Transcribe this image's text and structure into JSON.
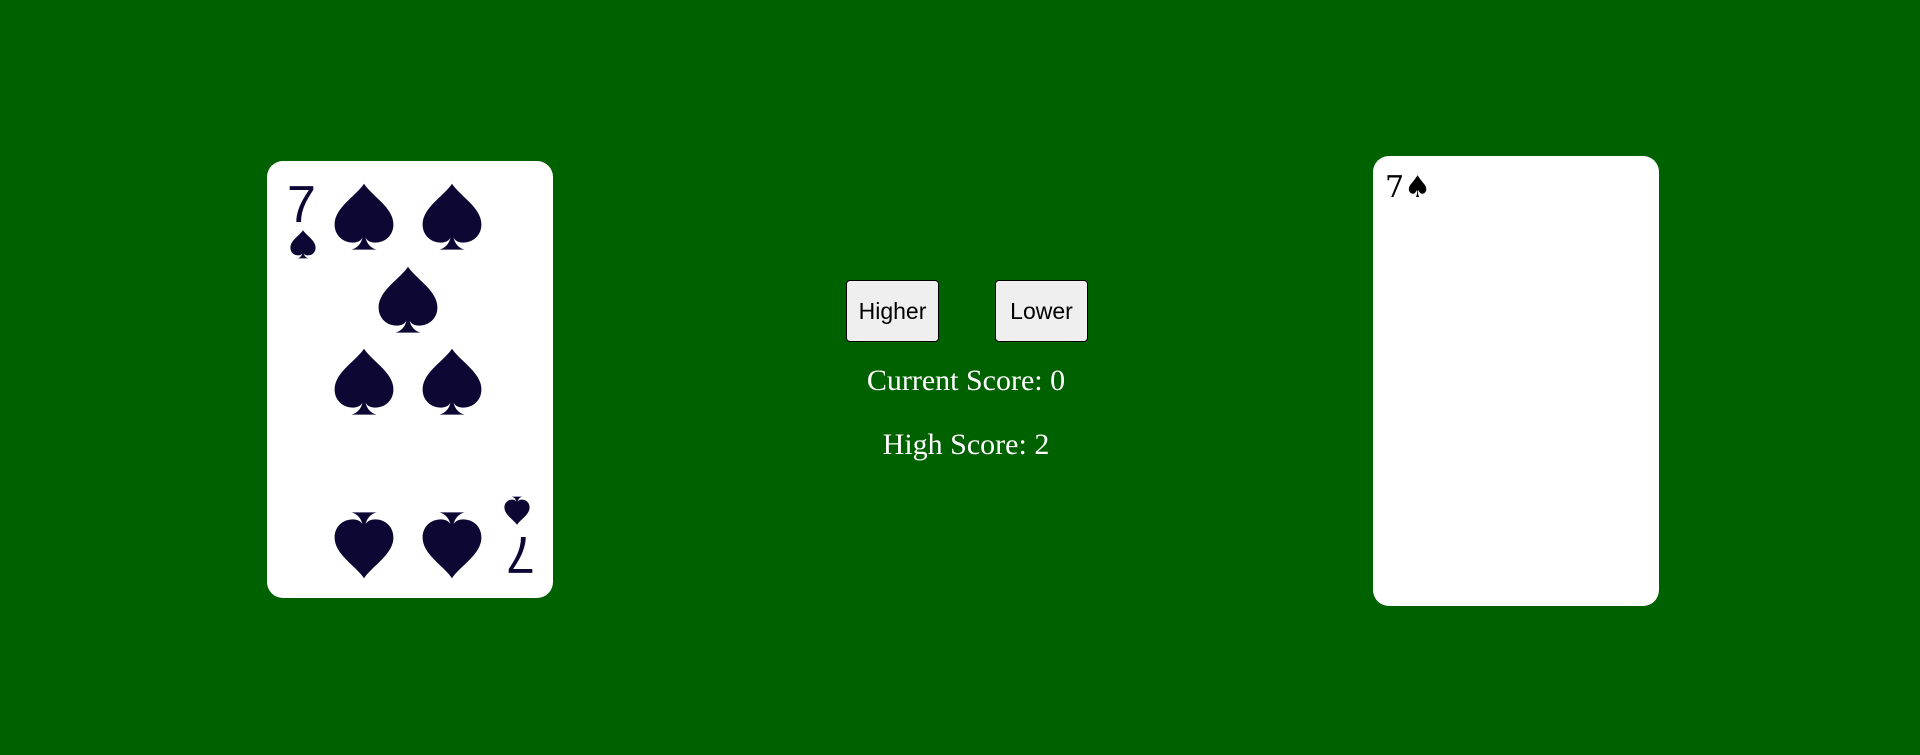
{
  "colors": {
    "table_felt": "#006100",
    "card_face": "#ffffff",
    "suit_ink": "#0d0833",
    "text_light": "#ffffff"
  },
  "current_card": {
    "rank": "7",
    "suit": "spades",
    "suit_icon": "spade-icon"
  },
  "next_card": {
    "label": "7♠"
  },
  "controls": {
    "higher_label": "Higher",
    "lower_label": "Lower"
  },
  "scores": {
    "current_text": "Current Score: 0",
    "high_text": "High Score: 2"
  }
}
